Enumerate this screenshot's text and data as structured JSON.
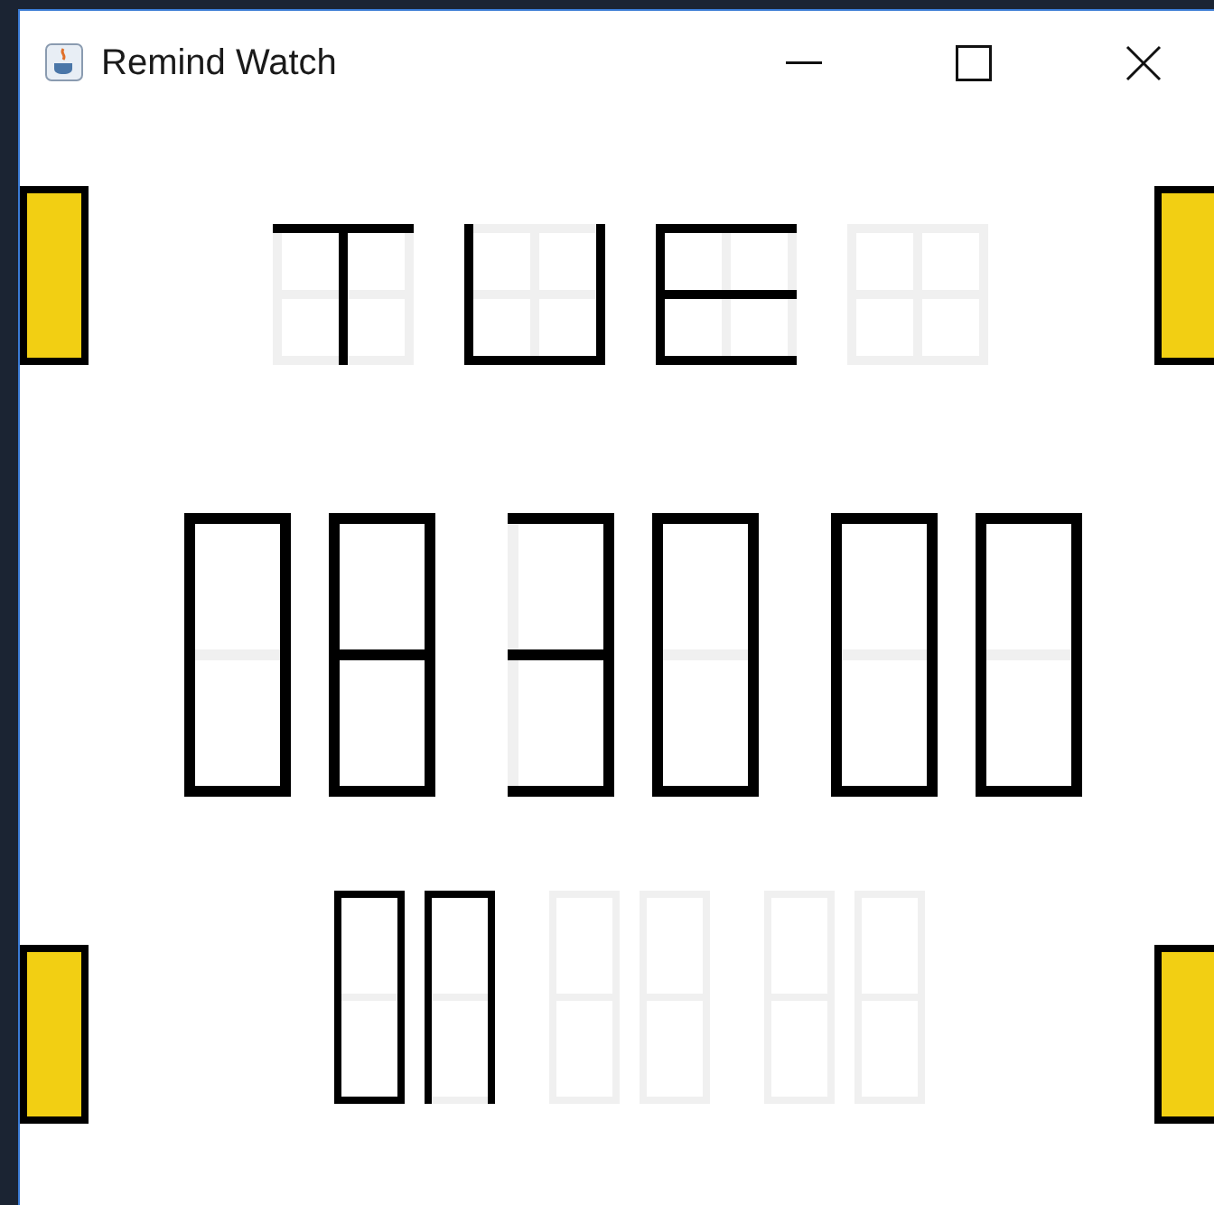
{
  "window": {
    "title": "Remind Watch"
  },
  "day_display": [
    {
      "kind": "letter",
      "segments": {
        "top": true,
        "upper_left": false,
        "upper_center": true,
        "upper_right": false,
        "middle": false,
        "lower_left": false,
        "lower_center": true,
        "lower_right": false,
        "bottom": false
      }
    },
    {
      "kind": "letter",
      "segments": {
        "top": false,
        "upper_left": true,
        "upper_center": false,
        "upper_right": true,
        "middle": false,
        "lower_left": true,
        "lower_center": false,
        "lower_right": true,
        "bottom": true
      }
    },
    {
      "kind": "letter",
      "segments": {
        "top": true,
        "upper_left": true,
        "upper_center": false,
        "upper_right": false,
        "middle": true,
        "lower_left": true,
        "lower_center": false,
        "lower_right": false,
        "bottom": true
      }
    },
    {
      "kind": "letter",
      "segments": {
        "top": false,
        "upper_left": false,
        "upper_center": false,
        "upper_right": false,
        "middle": false,
        "lower_left": false,
        "lower_center": false,
        "lower_right": false,
        "bottom": false
      }
    }
  ],
  "time_display": [
    {
      "digits": [
        {
          "kind": "digit",
          "segments": {
            "top": true,
            "upper_left": true,
            "upper_right": true,
            "middle": false,
            "lower_left": true,
            "lower_right": true,
            "bottom": true
          }
        },
        {
          "kind": "digit",
          "segments": {
            "top": true,
            "upper_left": true,
            "upper_right": true,
            "middle": true,
            "lower_left": true,
            "lower_right": true,
            "bottom": true
          }
        }
      ]
    },
    {
      "digits": [
        {
          "kind": "digit",
          "segments": {
            "top": true,
            "upper_left": false,
            "upper_right": true,
            "middle": true,
            "lower_left": false,
            "lower_right": true,
            "bottom": true
          }
        },
        {
          "kind": "digit",
          "segments": {
            "top": true,
            "upper_left": true,
            "upper_right": true,
            "middle": false,
            "lower_left": true,
            "lower_right": true,
            "bottom": true
          }
        }
      ]
    },
    {
      "digits": [
        {
          "kind": "digit",
          "segments": {
            "top": true,
            "upper_left": true,
            "upper_right": true,
            "middle": false,
            "lower_left": true,
            "lower_right": true,
            "bottom": true
          }
        },
        {
          "kind": "digit",
          "segments": {
            "top": true,
            "upper_left": true,
            "upper_right": true,
            "middle": false,
            "lower_left": true,
            "lower_right": true,
            "bottom": true
          }
        }
      ]
    }
  ],
  "alarm_display": [
    {
      "digits": [
        {
          "kind": "digit",
          "segments": {
            "top": true,
            "upper_left": true,
            "upper_right": true,
            "middle": false,
            "lower_left": true,
            "lower_right": true,
            "bottom": true
          }
        },
        {
          "kind": "digit",
          "segments": {
            "top": true,
            "upper_left": true,
            "upper_right": true,
            "middle": false,
            "lower_left": true,
            "lower_right": true,
            "bottom": false
          }
        }
      ]
    },
    {
      "digits": [
        {
          "kind": "digit",
          "segments": {
            "top": false,
            "upper_left": false,
            "upper_right": false,
            "middle": false,
            "lower_left": false,
            "lower_right": false,
            "bottom": false
          }
        },
        {
          "kind": "digit",
          "segments": {
            "top": false,
            "upper_left": false,
            "upper_right": false,
            "middle": false,
            "lower_left": false,
            "lower_right": false,
            "bottom": false
          }
        }
      ]
    },
    {
      "digits": [
        {
          "kind": "digit",
          "segments": {
            "top": false,
            "upper_left": false,
            "upper_right": false,
            "middle": false,
            "lower_left": false,
            "lower_right": false,
            "bottom": false
          }
        },
        {
          "kind": "digit",
          "segments": {
            "top": false,
            "upper_left": false,
            "upper_right": false,
            "middle": false,
            "lower_left": false,
            "lower_right": false,
            "bottom": false
          }
        }
      ]
    }
  ]
}
